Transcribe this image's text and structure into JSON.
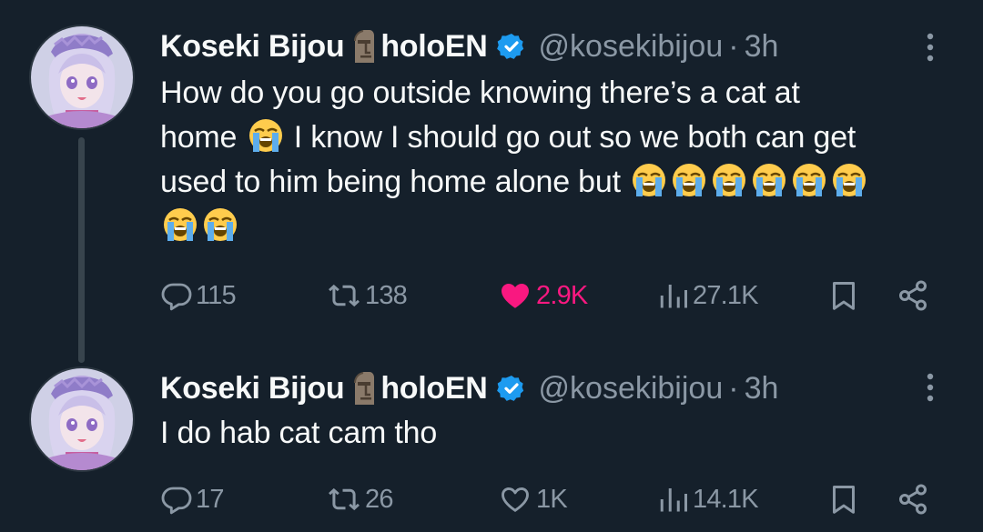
{
  "tweets": [
    {
      "author_name": "Koseki Bijou",
      "author_suffix": "holoEN",
      "name_emoji": "moai",
      "handle": "@kosekibijou",
      "separator": "·",
      "time": "3h",
      "text_lines": [
        "How do you go outside knowing there’s a cat at",
        "home",
        "I know I should go out so we both can get",
        "used to him being home alone but"
      ],
      "emoji": "loudly-crying-face",
      "stats": {
        "replies": "115",
        "reposts": "138",
        "likes": "2.9K",
        "views": "27.1K"
      },
      "liked": true
    },
    {
      "author_name": "Koseki Bijou",
      "author_suffix": "holoEN",
      "name_emoji": "moai",
      "handle": "@kosekibijou",
      "separator": "·",
      "time": "3h",
      "text": "I do hab cat cam tho",
      "stats": {
        "replies": "17",
        "reposts": "26",
        "likes": "1K",
        "views": "14.1K"
      },
      "liked": false
    }
  ],
  "colors": {
    "background": "#15202b",
    "primary_text": "#f7f9f9",
    "secondary_text": "#8b98a5",
    "verified": "#1d9bf0",
    "like": "#f91880",
    "thread_line": "#38444d"
  }
}
